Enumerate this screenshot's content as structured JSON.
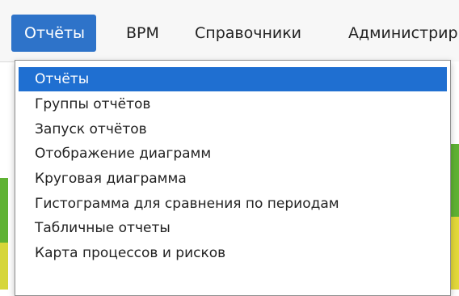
{
  "menubar": {
    "items": [
      {
        "label": "Отчёты",
        "active": true
      },
      {
        "label": "BPM"
      },
      {
        "label": "Справочники"
      },
      {
        "label": "Администрир"
      }
    ]
  },
  "dropdown": {
    "items": [
      {
        "label": "Отчёты",
        "selected": true
      },
      {
        "label": "Группы отчётов"
      },
      {
        "label": "Запуск отчётов"
      },
      {
        "label": "Отображение диаграмм"
      },
      {
        "label": "Круговая диаграмма"
      },
      {
        "label": "Гистограмма для сравнения по периодам"
      },
      {
        "label": "Табличные отчеты"
      },
      {
        "label": "Карта процессов и рисков"
      }
    ]
  },
  "colors": {
    "accent": "#2e73c9",
    "selected": "#1f6fd1",
    "background_green": "#5fb233",
    "background_yellow": "#e3d93a"
  }
}
